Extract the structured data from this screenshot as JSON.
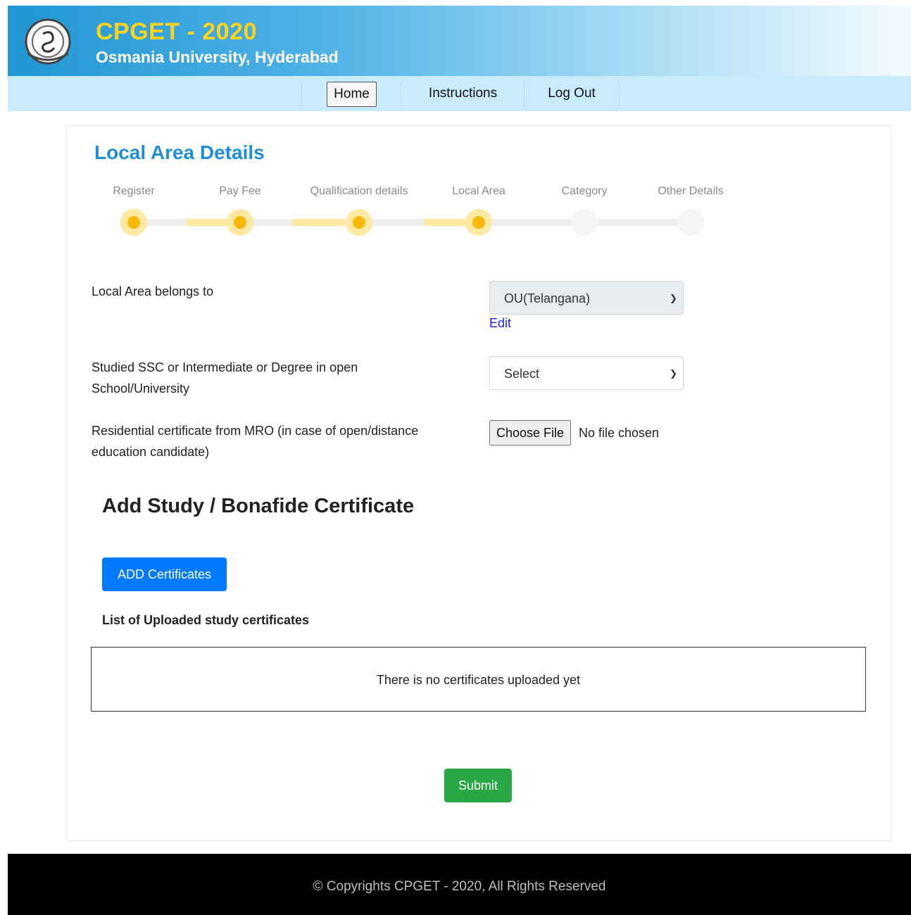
{
  "header": {
    "title": "CPGET - 2020",
    "subtitle": "Osmania University, Hyderabad",
    "logo_icon": "university-seal-icon"
  },
  "nav": {
    "items": [
      {
        "label": "Home"
      },
      {
        "label": "Instructions"
      },
      {
        "label": "Log Out"
      }
    ]
  },
  "main": {
    "title": "Local Area Details",
    "steps": [
      {
        "label": "Register",
        "done": true
      },
      {
        "label": "Pay Fee",
        "done": true
      },
      {
        "label": "Qualification details",
        "done": true
      },
      {
        "label": "Local Area",
        "done": true
      },
      {
        "label": "Category",
        "done": false
      },
      {
        "label": "Other Details",
        "done": false
      }
    ],
    "form": {
      "local_area_label": "Local Area belongs to",
      "local_area_value": "OU(Telangana)",
      "edit_label": "Edit",
      "open_school_label": "Studied SSC or Intermediate or Degree in open School/University",
      "open_school_value": "Select",
      "residential_label": "Residential certificate from MRO (in case of open/distance education candidate)",
      "choose_file_label": "Choose File",
      "file_status": "No file chosen"
    },
    "certificates": {
      "heading": "Add Study / Bonafide Certificate",
      "add_button": "ADD Certificates",
      "list_title": "List of Uploaded study certificates",
      "empty_message": "There is no certificates uploaded yet"
    },
    "submit_label": "Submit"
  },
  "footer": {
    "text": "© Copyrights CPGET - 2020, All Rights Reserved"
  },
  "colors": {
    "accent": "#1e8fd4",
    "brand_yellow": "#ffd21c",
    "step_done": "#f8b90a",
    "primary_button": "#007bff",
    "success_button": "#28a745"
  }
}
